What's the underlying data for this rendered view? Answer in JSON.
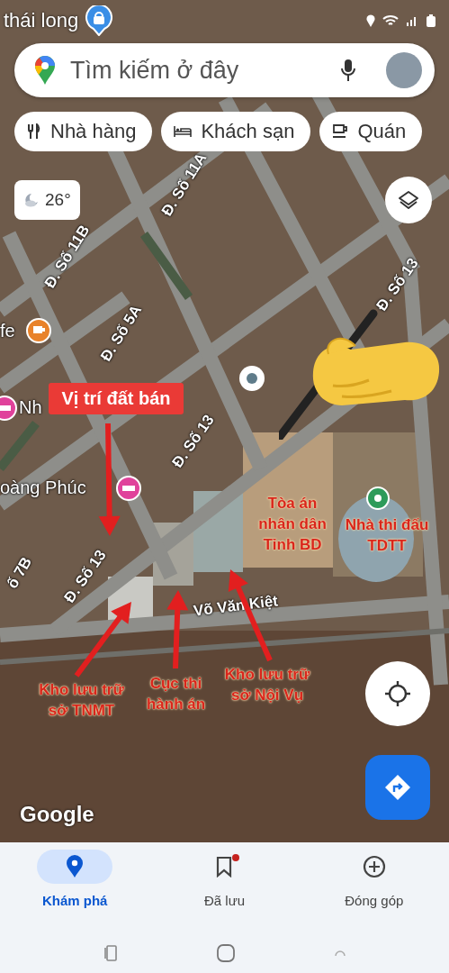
{
  "status_bar": {
    "text": "thái long"
  },
  "search": {
    "placeholder": "Tìm kiếm ở đây"
  },
  "chips": [
    {
      "label": "Nhà hàng",
      "kind": "restaurant"
    },
    {
      "label": "Khách sạn",
      "kind": "hotel"
    },
    {
      "label": "Quán",
      "kind": "cafe"
    }
  ],
  "weather": {
    "temperature": "26°"
  },
  "map": {
    "street_labels": [
      "Đ. Số 11A",
      "Đ. Số 11B",
      "Đ. Số 5A",
      "Đ. Số 13",
      "Đ. Số 13",
      "Đ. Số 13",
      "Võ Văn Kiệt",
      "ố 7B"
    ],
    "place_labels": [
      {
        "text": "fe",
        "kind": "cafe"
      },
      {
        "text": "Nh",
        "kind": "hotel"
      },
      {
        "text": "oàng Phúc",
        "kind": "hotel"
      }
    ],
    "annotations": [
      {
        "text": "Vị trí đất bán",
        "kind": "boxed"
      },
      {
        "text": "Tòa án\nnhân dân\nTỉnh BD",
        "kind": "plain"
      },
      {
        "text": "Nhà thi đấu\nTDTT",
        "kind": "plain"
      },
      {
        "text": "Kho lưu trữ\nsở TNMT",
        "kind": "plain"
      },
      {
        "text": "Cục thi\nhành án",
        "kind": "plain"
      },
      {
        "text": "Kho lưu trữ\nsở Nội Vụ",
        "kind": "plain"
      }
    ],
    "logo": "Google"
  },
  "nav": [
    {
      "label": "Khám phá",
      "kind": "explore",
      "selected": true,
      "notification": false
    },
    {
      "label": "Đã lưu",
      "kind": "saved",
      "selected": false,
      "notification": true
    },
    {
      "label": "Đóng góp",
      "kind": "contribute",
      "selected": false,
      "notification": false
    }
  ]
}
